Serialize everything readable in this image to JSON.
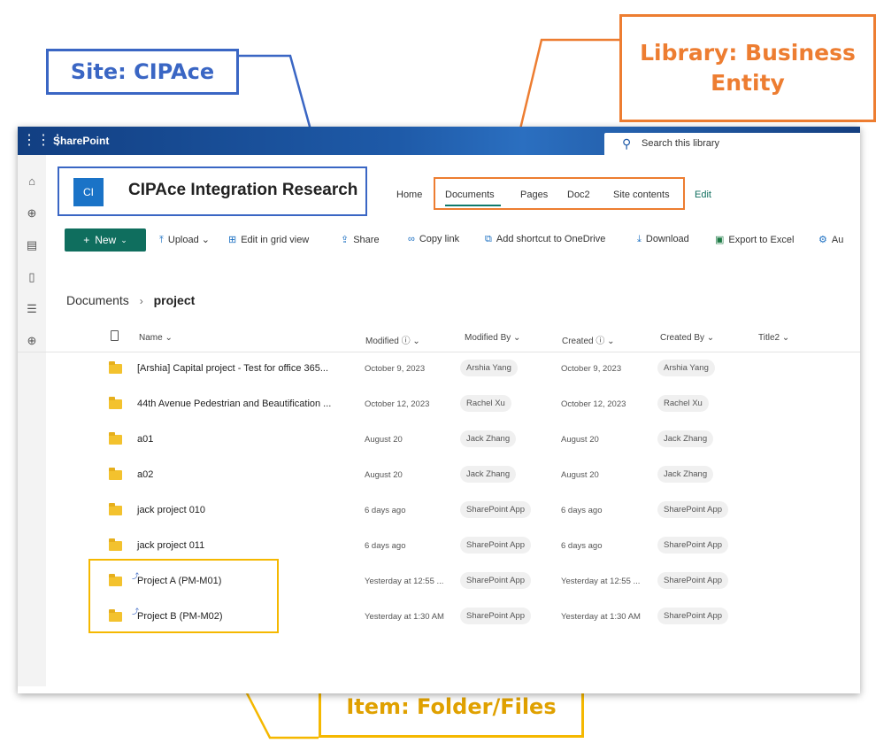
{
  "callouts": {
    "site": "Site: CIPAce",
    "library_line1": "Library: Business",
    "library_line2": "Entity",
    "item": "Item: Folder/Files"
  },
  "suitebar": {
    "waffle_icon": "waffle-icon",
    "brand": "SharePoint",
    "search_placeholder": "Search this library"
  },
  "site": {
    "logo": "CI",
    "title": "CIPAce Integration Research"
  },
  "nav": {
    "items": [
      "Home",
      "Documents",
      "Pages",
      "Doc2",
      "Site contents",
      "Edit"
    ],
    "active": "Documents"
  },
  "commandbar": {
    "new": "New",
    "upload": "Upload",
    "edit_grid": "Edit in grid view",
    "share": "Share",
    "copy_link": "Copy link",
    "add_shortcut": "Add shortcut to OneDrive",
    "download": "Download",
    "export": "Export to Excel",
    "automate": "Au"
  },
  "breadcrumb": {
    "root": "Documents",
    "current": "project"
  },
  "columns": {
    "name": "Name",
    "modified": "Modified",
    "modified_by": "Modified By",
    "created": "Created",
    "created_by": "Created By",
    "title2": "Title2"
  },
  "rows": [
    {
      "name": "[Arshia] Capital project - Test for office 365...",
      "modified": "October 9, 2023",
      "modified_by": "Arshia Yang",
      "created": "October 9, 2023",
      "created_by": "Arshia Yang",
      "shortcut": false
    },
    {
      "name": "44th Avenue Pedestrian and Beautification ...",
      "modified": "October 12, 2023",
      "modified_by": "Rachel Xu",
      "created": "October 12, 2023",
      "created_by": "Rachel Xu",
      "shortcut": false
    },
    {
      "name": "a01",
      "modified": "August 20",
      "modified_by": "Jack Zhang",
      "created": "August 20",
      "created_by": "Jack Zhang",
      "shortcut": false
    },
    {
      "name": "a02",
      "modified": "August 20",
      "modified_by": "Jack Zhang",
      "created": "August 20",
      "created_by": "Jack Zhang",
      "shortcut": false
    },
    {
      "name": "jack project 010",
      "modified": "6 days ago",
      "modified_by": "SharePoint App",
      "created": "6 days ago",
      "created_by": "SharePoint App",
      "shortcut": false
    },
    {
      "name": "jack project 011",
      "modified": "6 days ago",
      "modified_by": "SharePoint App",
      "created": "6 days ago",
      "created_by": "SharePoint App",
      "shortcut": false
    },
    {
      "name": "Project A (PM-M01)",
      "modified": "Yesterday at 12:55 ...",
      "modified_by": "SharePoint App",
      "created": "Yesterday at 12:55 ...",
      "created_by": "SharePoint App",
      "shortcut": true
    },
    {
      "name": "Project B (PM-M02)",
      "modified": "Yesterday at 1:30 AM",
      "modified_by": "SharePoint App",
      "created": "Yesterday at 1:30 AM",
      "created_by": "SharePoint App",
      "shortcut": true
    }
  ],
  "colors": {
    "site_callout": "#3a66c4",
    "library_callout": "#ed7d31",
    "item_callout": "#f5b800",
    "new_button": "#0f6e5e",
    "suitebar": "#0f3c7d"
  }
}
